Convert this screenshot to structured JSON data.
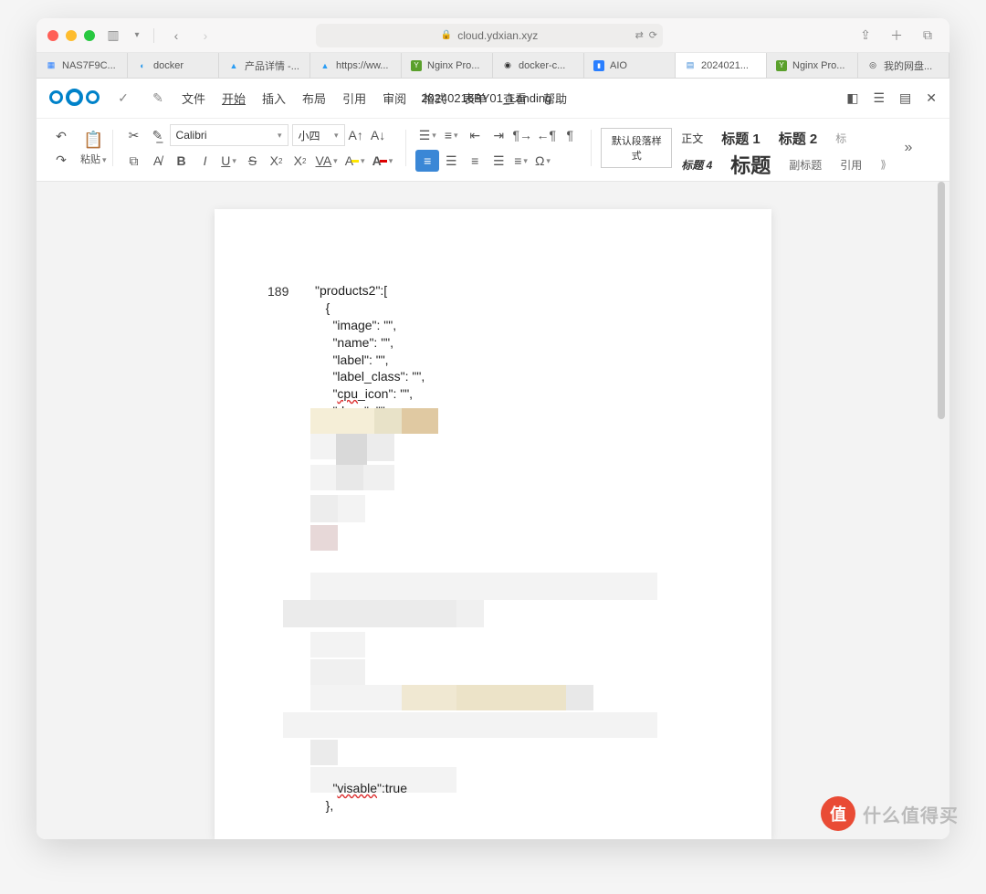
{
  "browser": {
    "url": "cloud.ydxian.xyz",
    "tabs": [
      {
        "label": "NAS7F9C...",
        "fav": "▦",
        "favcolor": "#2a7fff"
      },
      {
        "label": "docker",
        "fav": "🐳",
        "favcolor": "#2496ed"
      },
      {
        "label": "产品详情 -...",
        "fav": "▲",
        "favcolor": "#2a9df4"
      },
      {
        "label": "https://ww...",
        "fav": "▲",
        "favcolor": "#2a9df4"
      },
      {
        "label": "Nginx Pro...",
        "fav": "Y",
        "favcolor": "#5aa02c"
      },
      {
        "label": "docker-c...",
        "fav": "◉",
        "favcolor": "#333"
      },
      {
        "label": "AIO",
        "fav": "■",
        "favcolor": "#2a7fff"
      },
      {
        "label": "2024021...",
        "fav": "▤",
        "favcolor": "#3a87d6",
        "active": true
      },
      {
        "label": "Nginx Pro...",
        "fav": "Y",
        "favcolor": "#5aa02c"
      },
      {
        "label": "我的网盘...",
        "fav": "◎",
        "favcolor": "#333"
      }
    ]
  },
  "app": {
    "menus": [
      "文件",
      "开始",
      "插入",
      "布局",
      "引用",
      "审阅",
      "格式",
      "表单",
      "查看",
      "帮助"
    ],
    "active_menu": "开始",
    "doc_title": "20240216BY01_Landing ...",
    "paste_label": "粘贴",
    "font_name": "Calibri",
    "font_size": "小四",
    "style_default": "默认段落样式",
    "style_body": "正文",
    "style_h4": "标题 4",
    "style_title": "标题",
    "style_h1": "标题 1",
    "style_sub": "副标题",
    "style_h2": "标题 2",
    "style_quote": "引用",
    "style_more": "标"
  },
  "document": {
    "line_number": "189",
    "code_lines": [
      "\"products2\":[",
      "   {",
      "     \"image\": \"\",",
      "     \"name\": \"\",",
      "     \"label\": \"\",",
      "     \"label_class\": \"\",",
      "     \"<cpu>_icon\": \"\",",
      "     \"desc\": \"\","
    ],
    "code_end_pre": "     \"",
    "code_end_word": "visable",
    "code_end_post": "\":true",
    "code_close": "   },"
  },
  "watermark": {
    "badge": "值",
    "text": "什么值得买"
  }
}
